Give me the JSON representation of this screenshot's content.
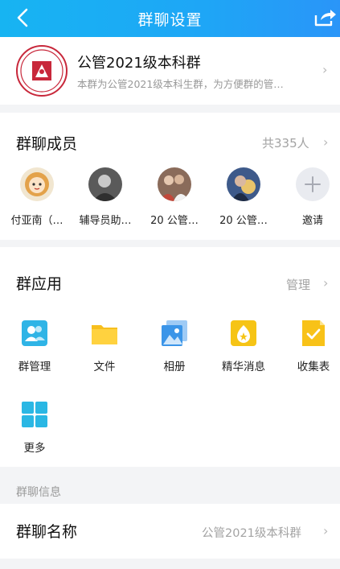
{
  "header": {
    "title": "群聊设置"
  },
  "group": {
    "name": "公管2021级本科群",
    "description": "本群为公管2021级本科生群，为方便群的管…"
  },
  "members": {
    "title": "群聊成员",
    "count": "共335人",
    "list": [
      {
        "label": "付亚南（…"
      },
      {
        "label": "辅导员助…"
      },
      {
        "label": "20 公管…"
      },
      {
        "label": "20 公管…"
      },
      {
        "label": "邀请"
      }
    ]
  },
  "apps": {
    "title": "群应用",
    "manage": "管理",
    "items": [
      {
        "label": "群管理",
        "icon": "group-manage-icon"
      },
      {
        "label": "文件",
        "icon": "folder-icon"
      },
      {
        "label": "相册",
        "icon": "photo-album-icon"
      },
      {
        "label": "精华消息",
        "icon": "essence-message-icon"
      },
      {
        "label": "收集表",
        "icon": "collection-form-icon"
      },
      {
        "label": "更多",
        "icon": "more-apps-icon"
      }
    ]
  },
  "info": {
    "section_label": "群聊信息",
    "name_label": "群聊名称",
    "name_value": "公管2021级本科群"
  },
  "colors": {
    "header_start": "#17b4f2",
    "header_end": "#2a95f8",
    "accent": "#1ea6f6"
  }
}
